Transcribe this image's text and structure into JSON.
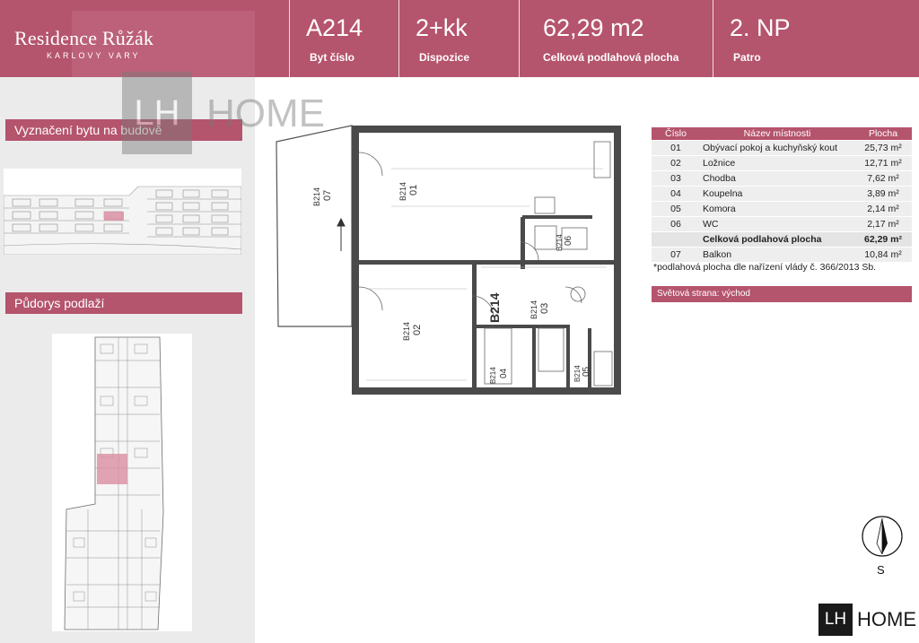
{
  "header": {
    "brand_name": "Residence Růžák",
    "brand_city": "KARLOVY VARY",
    "cells": [
      {
        "value": "A214",
        "label": "Byt číslo"
      },
      {
        "value": "2+kk",
        "label": "Dispozice"
      },
      {
        "value": "62,29 m2",
        "label": "Celková podlahová plocha"
      },
      {
        "value": "2. NP",
        "label": "Patro"
      }
    ]
  },
  "left": {
    "section_building": "Vyznačení bytu na budově",
    "section_floor": "Půdorys podlaží"
  },
  "watermark": {
    "box": "LH",
    "text": "HOME"
  },
  "plan": {
    "unit_label": "B214",
    "rooms": [
      {
        "code": "B214",
        "num": "01"
      },
      {
        "code": "B214",
        "num": "02"
      },
      {
        "code": "B214",
        "num": "03"
      },
      {
        "code": "B214",
        "num": "04"
      },
      {
        "code": "B214",
        "num": "05"
      },
      {
        "code": "B214",
        "num": "06"
      },
      {
        "code": "B214",
        "num": "07"
      }
    ]
  },
  "table": {
    "headers": [
      "Číslo",
      "Název místnosti",
      "Plocha"
    ],
    "rows": [
      {
        "num": "01",
        "name": "Obývací pokoj a kuchyňský kout",
        "area": "25,73 m²"
      },
      {
        "num": "02",
        "name": "Ložnice",
        "area": "12,71 m²"
      },
      {
        "num": "03",
        "name": "Chodba",
        "area": "7,62 m²"
      },
      {
        "num": "04",
        "name": "Koupelna",
        "area": "3,89 m²"
      },
      {
        "num": "05",
        "name": "Komora",
        "area": "2,14 m²"
      },
      {
        "num": "06",
        "name": "WC",
        "area": "2,17 m²"
      }
    ],
    "total": {
      "name": "Celková podlahová plocha",
      "area": "62,29 m²"
    },
    "balcony": {
      "num": "07",
      "name": "Balkon",
      "area": "10,84 m²"
    },
    "footnote": "*podlahová plocha dle nařízení vlády č. 366/2013 Sb.",
    "orientation": "Světová strana: východ"
  },
  "compass": {
    "letter": "S",
    "icon": "compass-icon"
  },
  "logo": {
    "box": "LH",
    "text": "HOME"
  },
  "colors": {
    "accent": "#b5546d",
    "panel": "#ebebeb"
  }
}
